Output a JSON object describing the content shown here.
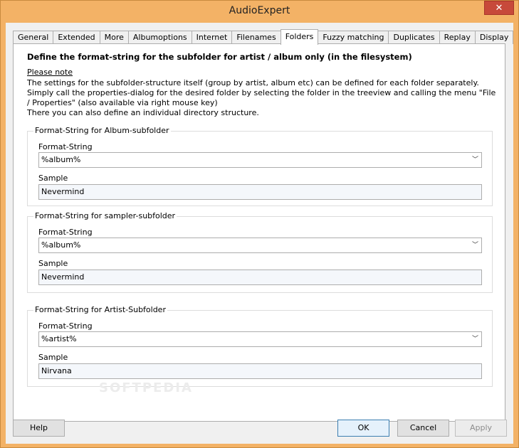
{
  "window": {
    "title": "AudioExpert",
    "close_symbol": "✕"
  },
  "tabs": [
    {
      "label": "General",
      "active": false
    },
    {
      "label": "Extended",
      "active": false
    },
    {
      "label": "More",
      "active": false
    },
    {
      "label": "Albumoptions",
      "active": false
    },
    {
      "label": "Internet",
      "active": false
    },
    {
      "label": "Filenames",
      "active": false
    },
    {
      "label": "Folders",
      "active": true
    },
    {
      "label": "Fuzzy matching",
      "active": false
    },
    {
      "label": "Duplicates",
      "active": false
    },
    {
      "label": "Replay",
      "active": false
    },
    {
      "label": "Display",
      "active": false
    }
  ],
  "panel": {
    "heading": "Define the format-string for the subfolder for artist / album only (in the filesystem)",
    "note_link": "Please note",
    "description": "The settings for the subfolder-structure itself (group by artist, album etc) can be defined for each folder separately. Simply call the properties-dialog for the desired folder by selecting the folder in the treeview and calling the menu \"File / Properties\" (also available via right mouse key)\nThere you can also define an individual directory structure."
  },
  "groups": {
    "album": {
      "legend": "Format-String for Album-subfolder",
      "format_label": "Format-String",
      "format_value": "%album%",
      "sample_label": "Sample",
      "sample_value": "Nevermind"
    },
    "sampler": {
      "legend": "Format-String for sampler-subfolder",
      "format_label": "Format-String",
      "format_value": "%album%",
      "sample_label": "Sample",
      "sample_value": "Nevermind"
    },
    "artist": {
      "legend": "Format-String for Artist-Subfolder",
      "format_label": "Format-String",
      "format_value": "%artist%",
      "sample_label": "Sample",
      "sample_value": "Nirvana"
    }
  },
  "watermark": "SOFTPEDIA",
  "buttons": {
    "help": "Help",
    "ok": "OK",
    "cancel": "Cancel",
    "apply": "Apply"
  },
  "chevron": "﹀"
}
